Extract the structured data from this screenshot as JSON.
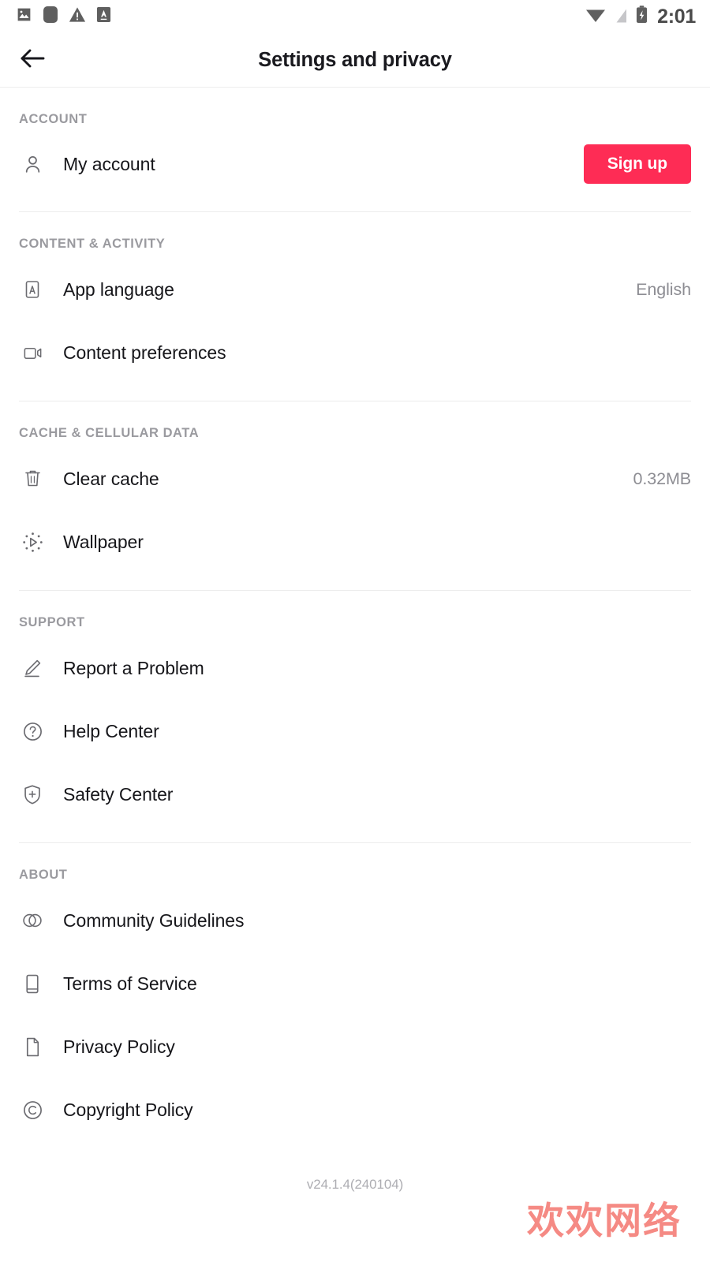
{
  "status_bar": {
    "time": "2:01",
    "left_icons": [
      "image-icon",
      "rounded-square-icon",
      "warning-triangle-icon",
      "a-badge-icon"
    ],
    "right_icons": [
      "wifi-icon",
      "cellular-off-icon",
      "battery-charging-icon"
    ]
  },
  "header": {
    "title": "Settings and privacy",
    "back_icon": "arrow-left-icon"
  },
  "colors": {
    "accent": "#fe2c55",
    "section_label": "#9a9a9f",
    "row_label": "#16161a",
    "row_value": "#8d8d93",
    "divider": "#ececec",
    "watermark": "#f4766f"
  },
  "sections": [
    {
      "label": "ACCOUNT",
      "rows": [
        {
          "icon": "person-icon",
          "label": "My account",
          "action_label": "Sign up",
          "value": ""
        }
      ]
    },
    {
      "label": "CONTENT & ACTIVITY",
      "rows": [
        {
          "icon": "language-a-icon",
          "label": "App language",
          "value": "English"
        },
        {
          "icon": "video-camera-icon",
          "label": "Content preferences",
          "value": ""
        }
      ]
    },
    {
      "label": "CACHE & CELLULAR DATA",
      "rows": [
        {
          "icon": "trash-icon",
          "label": "Clear cache",
          "value": "0.32MB"
        },
        {
          "icon": "wallpaper-play-icon",
          "label": "Wallpaper",
          "value": ""
        }
      ]
    },
    {
      "label": "SUPPORT",
      "rows": [
        {
          "icon": "pencil-icon",
          "label": "Report a Problem",
          "value": ""
        },
        {
          "icon": "question-circle-icon",
          "label": "Help Center",
          "value": ""
        },
        {
          "icon": "shield-plus-icon",
          "label": "Safety Center",
          "value": ""
        }
      ]
    },
    {
      "label": "ABOUT",
      "rows": [
        {
          "icon": "overlapping-circles-icon",
          "label": "Community Guidelines",
          "value": ""
        },
        {
          "icon": "book-icon",
          "label": "Terms of Service",
          "value": ""
        },
        {
          "icon": "document-icon",
          "label": "Privacy Policy",
          "value": ""
        },
        {
          "icon": "copyright-icon",
          "label": "Copyright Policy",
          "value": ""
        }
      ]
    }
  ],
  "footer": {
    "version": "v24.1.4(240104)",
    "watermark": "欢欢网络"
  }
}
